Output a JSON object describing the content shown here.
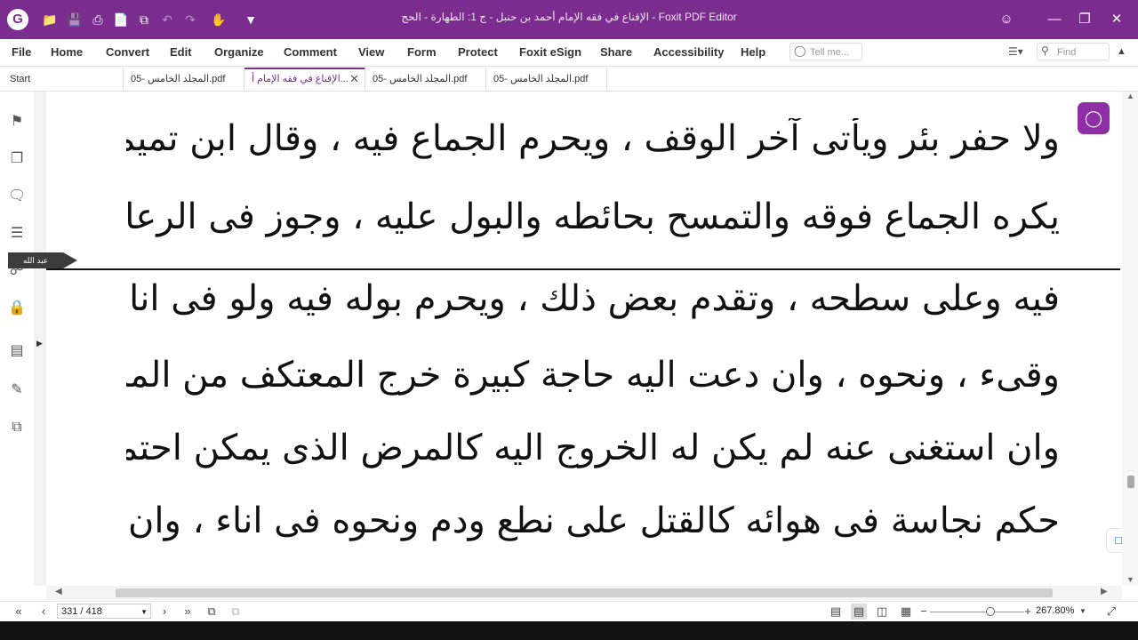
{
  "app": {
    "window_title": "الإقناع في فقه الإمام أحمد بن حنبل - ج 1: الطهارة - الحج - Foxit PDF Editor",
    "logo_letter": "G",
    "accent_color": "#7b2c8f"
  },
  "quick_access": [
    "folder-open-icon",
    "save-icon",
    "print-icon",
    "new-document-icon",
    "create-pdf-icon",
    "undo-icon",
    "redo-icon",
    "hand-tool-icon",
    "customize-icon"
  ],
  "menu": {
    "items": [
      "File",
      "Home",
      "Convert",
      "Edit",
      "Organize",
      "Comment",
      "View",
      "Form",
      "Protect",
      "Foxit eSign",
      "Share",
      "Accessibility",
      "Help"
    ],
    "tell_me_placeholder": "Tell me...",
    "find_placeholder": "Find"
  },
  "tabs": [
    {
      "label": "Start"
    },
    {
      "label": "المجلد الخامس -05.pdf"
    },
    {
      "label": "الإقناع في فقه الإمام أ..."
    },
    {
      "label": "المجلد الخامس -05.pdf"
    },
    {
      "label": "المجلد الخامس -05.pdf"
    }
  ],
  "sidebar_icons": [
    "bookmark-icon",
    "pages-icon",
    "comment-icon",
    "layers-icon",
    "attachment-icon",
    "security-icon",
    "document-icon",
    "signature-icon",
    "compare-icon"
  ],
  "document": {
    "lines": [
      "ولا حفر بئر ويأتى آخر الوقف ، ويحرم الجماع فيه ، وقال ابن تميم :",
      "يكره الجماع فوقه والتمسح بحائطه والبول عليه ، وجوز فى الرعاية الوطء",
      "فيه وعلى سطحه ، وتقدم بعض ذلك ، ويحرم بوله فيه ولو فى اناء وفصد وحجامة",
      "وقىء ، ونحوه ، وان دعت اليه حاجة كبيرة خرج المعتكف من المسجد ففعله",
      "وان استغنى عنه لم يكن له الخروج اليه كالمرض الذى يمكن احتماله ، وكذا",
      "حكم نجاسة فى هوائه كالقتل على نطع ودم ونحوه فى اناء ، وان بال خارجه"
    ],
    "annotation_author": "عبد الله"
  },
  "status": {
    "page_display": "331 / 418",
    "zoom": "267.80%",
    "zoom_level_fraction": 0.6
  }
}
